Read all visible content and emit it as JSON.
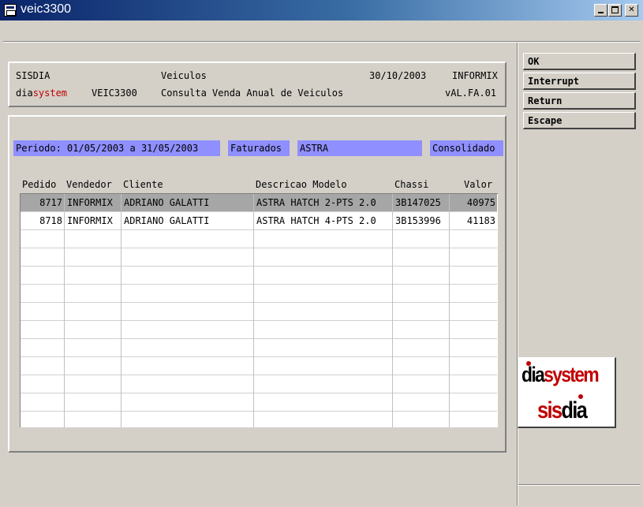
{
  "window": {
    "title": "veic3300",
    "controls": {
      "minimize": "minimize-icon",
      "maximize": "maximize-icon",
      "close": "close-icon"
    }
  },
  "header": {
    "system": "SISDIA",
    "module": "Veiculos",
    "date": "30/10/2003",
    "database": "INFORMIX",
    "brand_prefix": "dia",
    "brand_suffix": "system",
    "program": "VEIC3300",
    "description": "Consulta Venda Anual de Veiculos",
    "version": "vAL.FA.01"
  },
  "filters": {
    "periodo": "Periodo: 01/05/2003 a 31/05/2003",
    "status": "Faturados",
    "modelo": "ASTRA",
    "tipo": "Consolidado"
  },
  "table": {
    "columns": [
      "Pedido",
      "Vendedor",
      "Cliente",
      "Descricao Modelo",
      "Chassi",
      "Valor"
    ],
    "rows": [
      {
        "pedido": "8717",
        "vendedor": "INFORMIX",
        "cliente": "ADRIANO GALATTI",
        "modelo": "ASTRA HATCH 2-PTS 2.0",
        "chassi": "3B147025",
        "valor": "40975",
        "selected": true
      },
      {
        "pedido": "8718",
        "vendedor": "INFORMIX",
        "cliente": "ADRIANO GALATTI",
        "modelo": "ASTRA HATCH 4-PTS 2.0",
        "chassi": "3B153996",
        "valor": "41183",
        "selected": false
      }
    ]
  },
  "buttons": {
    "ok": "OK",
    "interrupt": "Interrupt",
    "return": "Return",
    "escape": "Escape"
  },
  "logo": {
    "line1_a": "dia",
    "line1_b": "system",
    "line2_a": "sis",
    "line2_b": "dia"
  },
  "colors": {
    "field_bg": "#8f8fff",
    "brand_red": "#c00000",
    "titlebar": "#0a246a"
  }
}
